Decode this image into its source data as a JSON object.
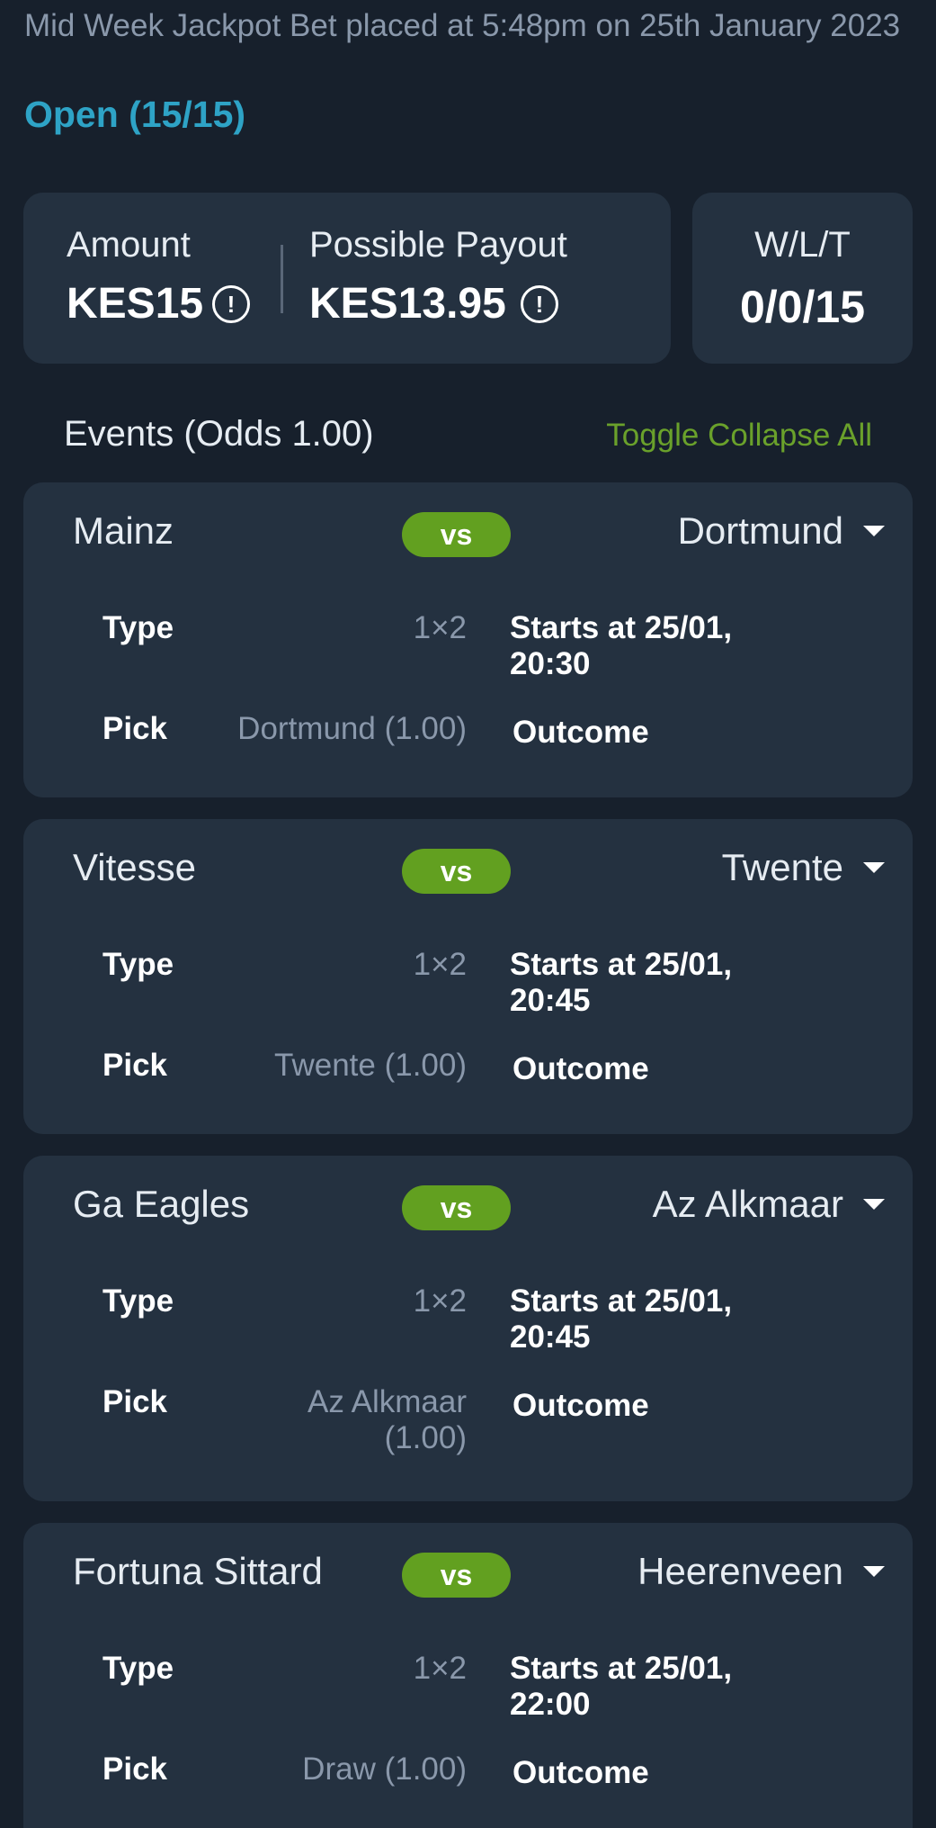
{
  "bet": {
    "title": "Mid Week Jackpot Bet placed at 5:48pm on 25th January 2023",
    "status": "Open (15/15)"
  },
  "summary": {
    "amount_label": "Amount",
    "amount_value": "KES15",
    "payout_label": "Possible Payout",
    "payout_value": "KES13.95",
    "wlt_label": "W/L/T",
    "wlt_value": "0/0/15",
    "info_glyph": "!"
  },
  "events_header": {
    "label": "Events (Odds 1.00)",
    "toggle_label": "Toggle Collapse All"
  },
  "labels": {
    "vs": "vs",
    "type": "Type",
    "pick": "Pick",
    "outcome": "Outcome"
  },
  "events": [
    {
      "home": "Mainz",
      "away": "Dortmund",
      "type": "1×2",
      "starts": "Starts at 25/01, 20:30",
      "pick": "Dortmund (1.00)"
    },
    {
      "home": "Vitesse",
      "away": "Twente",
      "type": "1×2",
      "starts": "Starts at 25/01, 20:45",
      "pick": "Twente (1.00)"
    },
    {
      "home": "Ga Eagles",
      "away": "Az Alkmaar",
      "type": "1×2",
      "starts": "Starts at 25/01, 20:45",
      "pick": "Az Alkmaar (1.00)"
    },
    {
      "home": "Fortuna Sittard",
      "away": "Heerenveen",
      "type": "1×2",
      "starts": "Starts at 25/01, 22:00",
      "pick": "Draw (1.00)"
    }
  ],
  "icons": {
    "info": "info-icon",
    "expand": "chevron-down-icon"
  },
  "colors": {
    "background": "#17202c",
    "card": "#243140",
    "status": "#2ea3c6",
    "accent_green": "#62a020",
    "link_green": "#6aa12b",
    "muted_text": "#8a98ab"
  }
}
